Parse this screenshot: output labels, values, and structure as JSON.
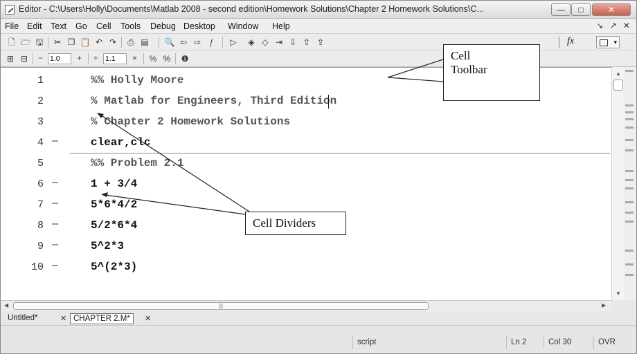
{
  "window": {
    "title": "Editor - C:\\Users\\Holly\\Documents\\Matlab 2008 - second edition\\Homework Solutions\\Chapter 2 Homework Solutions\\C...",
    "buttons": {
      "minimize": "—",
      "maximize": "□",
      "close": "✕"
    }
  },
  "menu": {
    "items": [
      "File",
      "Edit",
      "Text",
      "Go",
      "Cell",
      "Tools",
      "Debug",
      "Desktop",
      "Window",
      "Help"
    ],
    "right_controls": "↘ ↗ ✕"
  },
  "toolbar": {
    "icons": [
      "new-file-icon",
      "open-file-icon",
      "save-icon",
      "cut-icon",
      "copy-icon",
      "paste-icon",
      "undo-icon",
      "redo-icon",
      "print-icon",
      "history-icon",
      "find-icon",
      "back-icon",
      "forward-icon",
      "function-icon",
      "run-icon",
      "breakpoint-icon",
      "clear-breakpoints-icon",
      "step-icon",
      "step-in-icon",
      "step-out-icon"
    ],
    "fx_label": "fx"
  },
  "cell_toolbar": {
    "decrement": "−",
    "increment": "+",
    "divide": "÷",
    "multiply": "×",
    "value1": "1.0",
    "value2": "1.1"
  },
  "editor": {
    "lines": [
      {
        "num": "1",
        "dash": "",
        "text": "%% Holly Moore",
        "comment": true
      },
      {
        "num": "2",
        "dash": "",
        "text": "% Matlab for Engineers, Third Edition",
        "comment": true
      },
      {
        "num": "3",
        "dash": "",
        "text": "% Chapter 2 Homework Solutions",
        "comment": true
      },
      {
        "num": "4",
        "dash": "—",
        "text": "clear,clc",
        "comment": false
      },
      {
        "num": "5",
        "dash": "",
        "text": "%% Problem 2.1",
        "comment": true
      },
      {
        "num": "6",
        "dash": "—",
        "text": "1 + 3/4",
        "comment": false
      },
      {
        "num": "7",
        "dash": "—",
        "text": "5*6*4/2",
        "comment": false
      },
      {
        "num": "8",
        "dash": "—",
        "text": "5/2*6*4",
        "comment": false
      },
      {
        "num": "9",
        "dash": "—",
        "text": "5^2*3",
        "comment": false
      },
      {
        "num": "10",
        "dash": "—",
        "text": "5^(2*3)",
        "comment": false
      }
    ]
  },
  "tabs": [
    {
      "label": "Untitled*",
      "active": false
    },
    {
      "label": "CHAPTER 2.M*",
      "active": true
    }
  ],
  "status": {
    "mode": "script",
    "line": "Ln  2",
    "col": "Col  30",
    "ovr": "OVR"
  },
  "annotations": {
    "cell_toolbar": "Cell\nToolbar",
    "cell_dividers": "Cell Dividers"
  }
}
